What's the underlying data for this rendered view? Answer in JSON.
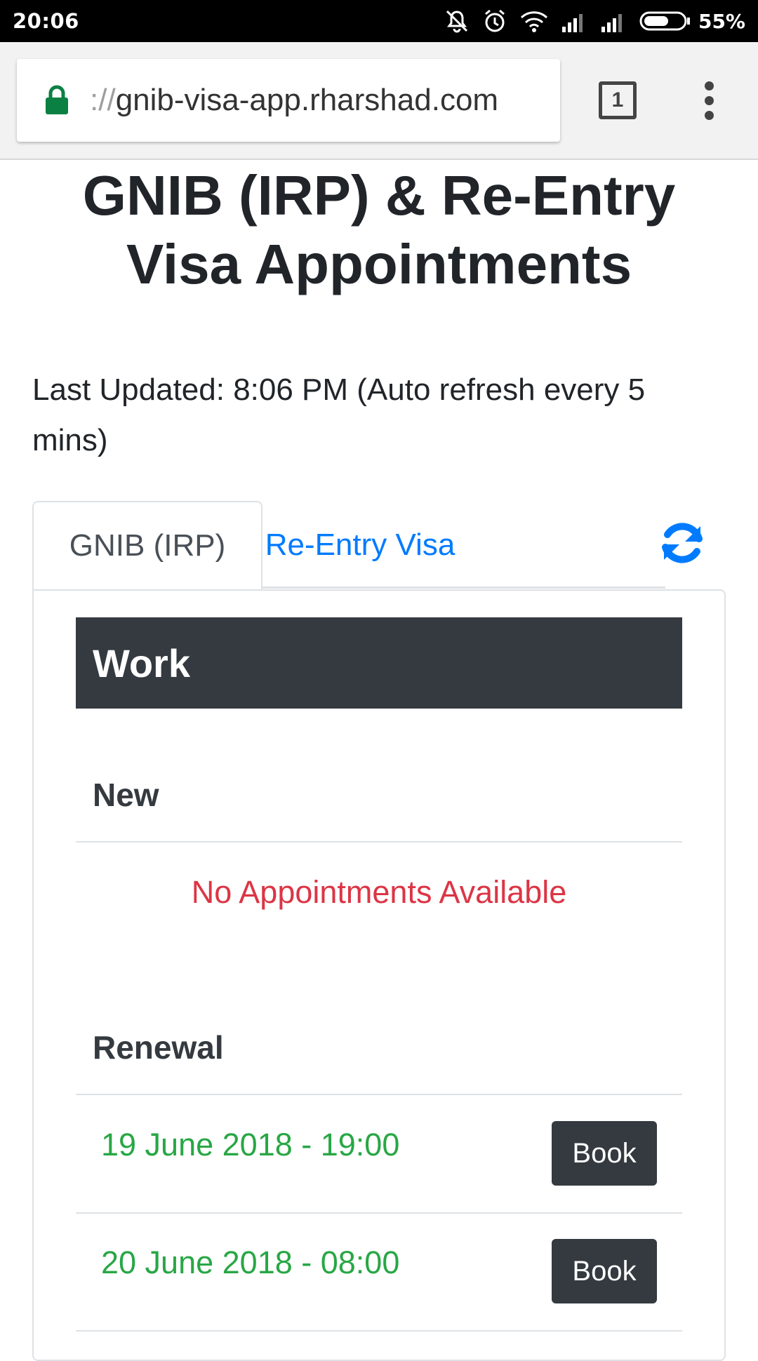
{
  "status_bar": {
    "time": "20:06",
    "battery_percent": "55%",
    "icons": [
      "mute-icon",
      "alarm-icon",
      "wifi-icon",
      "signal-icon",
      "signal-icon",
      "battery-icon"
    ]
  },
  "browser": {
    "url_prefix": "://",
    "url_host": "gnib-visa-app.rharshad.com",
    "tab_count": "1"
  },
  "page": {
    "title_line1": "GNIB (IRP) & Re-Entry",
    "title_line2": "Visa Appointments",
    "last_updated_line1": "Last Updated: 8:06 PM (Auto refresh every 5",
    "last_updated_line2": "mins)"
  },
  "tabs": [
    {
      "label": "GNIB (IRP)",
      "active": true
    },
    {
      "label": "Re-Entry Visa",
      "active": false
    }
  ],
  "category": "Work",
  "sections": {
    "new": {
      "label": "New",
      "message": "No Appointments Available"
    },
    "renewal": {
      "label": "Renewal",
      "slots": [
        {
          "time": "19 June 2018 - 19:00",
          "button": "Book"
        },
        {
          "time": "20 June 2018 - 08:00",
          "button": "Book"
        }
      ]
    }
  },
  "colors": {
    "success": "#28a745",
    "danger": "#dc3545",
    "link": "#007bff",
    "dark": "#343a40"
  }
}
